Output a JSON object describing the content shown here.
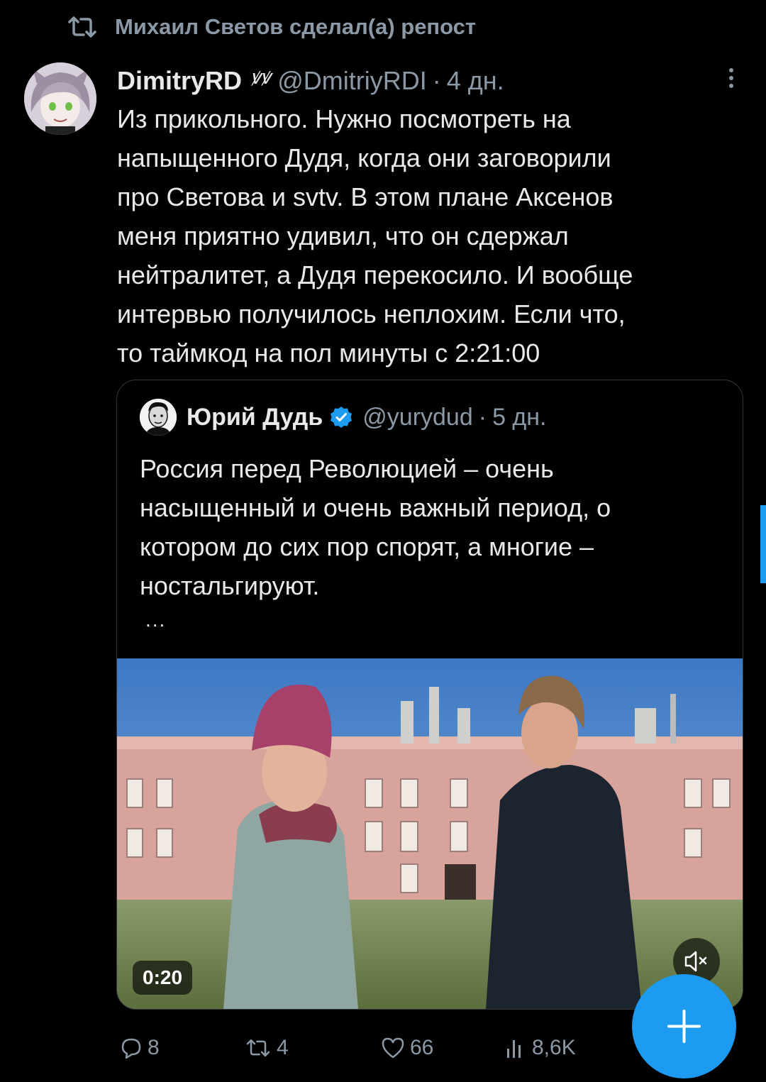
{
  "repost": {
    "text": "Михаил Светов сделал(а) репост"
  },
  "tweet": {
    "author_name": "DimitryRD",
    "author_badge": "ꝟꝟ",
    "handle": "@DmitriyRDI",
    "separator": "·",
    "time": "4 дн.",
    "lines": [
      "Из прикольного. Нужно посмотреть на",
      "напыщенного Дудя, когда они заговорили",
      "про Светова и svtv. В этом плане Аксенов",
      "меня приятно удивил, что он сдержал",
      "нейтралитет, а Дудя перекосило. И вообще",
      "интервью получилось неплохим. Если что,",
      "то таймкод на пол минуты с 2:21:00"
    ]
  },
  "quote": {
    "author_name": "Юрий Дудь",
    "handle": "@yurydud",
    "separator": "·",
    "time": "5 дн.",
    "lines": [
      "Россия перед Революцией – очень",
      "насыщенный и очень важный период, о",
      "котором до сих пор спорят, а многие –",
      "ностальгируют."
    ],
    "ellipsis": "...",
    "video": {
      "duration": "0:20",
      "mute_icon": "speaker-muted-icon"
    }
  },
  "actions": {
    "replies": "8",
    "reposts": "4",
    "likes": "66",
    "views": "8,6K"
  },
  "fab": {
    "icon": "plus-icon"
  },
  "colors": {
    "accent": "#1d9bf0",
    "muted": "#8b98a5",
    "text": "#e7e9ea",
    "background": "#000000"
  }
}
